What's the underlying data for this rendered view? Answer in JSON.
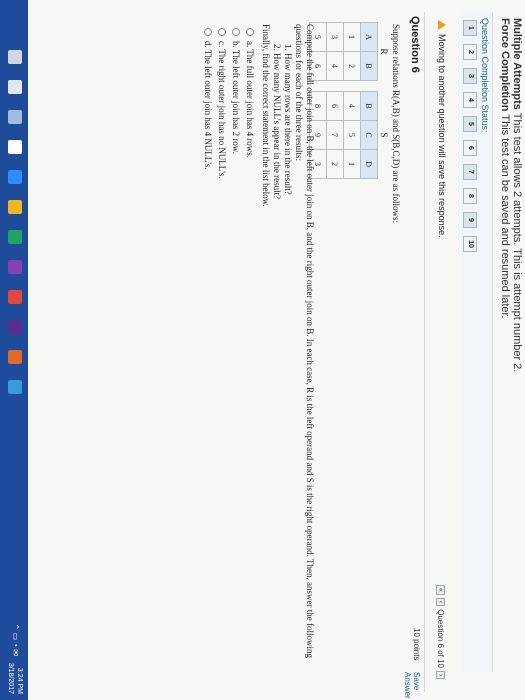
{
  "header": {
    "line1_bold": "Multiple Attempts",
    "line1_rest": "This test allows 2 attempts. This is attempt number 2.",
    "line2_bold": "Force Completion",
    "line2_rest": "This test can be saved and resumed later."
  },
  "status": {
    "label": "Question Completion Status:",
    "questions": [
      "1",
      "2",
      "3",
      "4",
      "5",
      "6",
      "7",
      "8",
      "9",
      "10"
    ]
  },
  "nav": {
    "message": "Moving to another question will save this response.",
    "pager": "Question 6 of 10"
  },
  "question": {
    "title": "Question 6",
    "points": "10 points",
    "save": "Save Answer",
    "prompt": "Suppose relations R(A,B) and S(B,C,D) are as follows:",
    "R": {
      "caption": "R",
      "headers": [
        "A",
        "B"
      ],
      "rows": [
        [
          "1",
          "2"
        ],
        [
          "3",
          "4"
        ],
        [
          "5",
          "6"
        ]
      ]
    },
    "S": {
      "caption": "S",
      "headers": [
        "B",
        "C",
        "D"
      ],
      "rows": [
        [
          "4",
          "5",
          "1"
        ],
        [
          "6",
          "7",
          "2"
        ],
        [
          "8",
          "9",
          "3"
        ]
      ]
    },
    "para_main": "Compute the full outer join on B, the left outer join on B, and the right outer join on B. In each case, R is the left operand and S is the right operand. Then, answer the following questions for each of the three results:",
    "sub1": "1.   How many rows are there in the result?",
    "sub2": "2.   How many NULL's appear in the result?",
    "para_final": "Finally, find the correct statement in the list below.",
    "options": [
      "a. The full outer join has 4 rows.",
      "b. The left outer join has 2 row.",
      "c. The right outer join has no NULL's.",
      "d. The left outer join has 4 NULL's."
    ]
  },
  "taskbar": {
    "time": "3:24 PM",
    "date": "3/18/2017",
    "colors": [
      "#cfd6e0",
      "#e3e8ef",
      "#9fbce0",
      "#ffffff",
      "#2d8cff",
      "#f3b623",
      "#21a366",
      "#8b3fb5",
      "#e1473d",
      "#5c2d91",
      "#e06a2c",
      "#3a9ad9"
    ]
  }
}
